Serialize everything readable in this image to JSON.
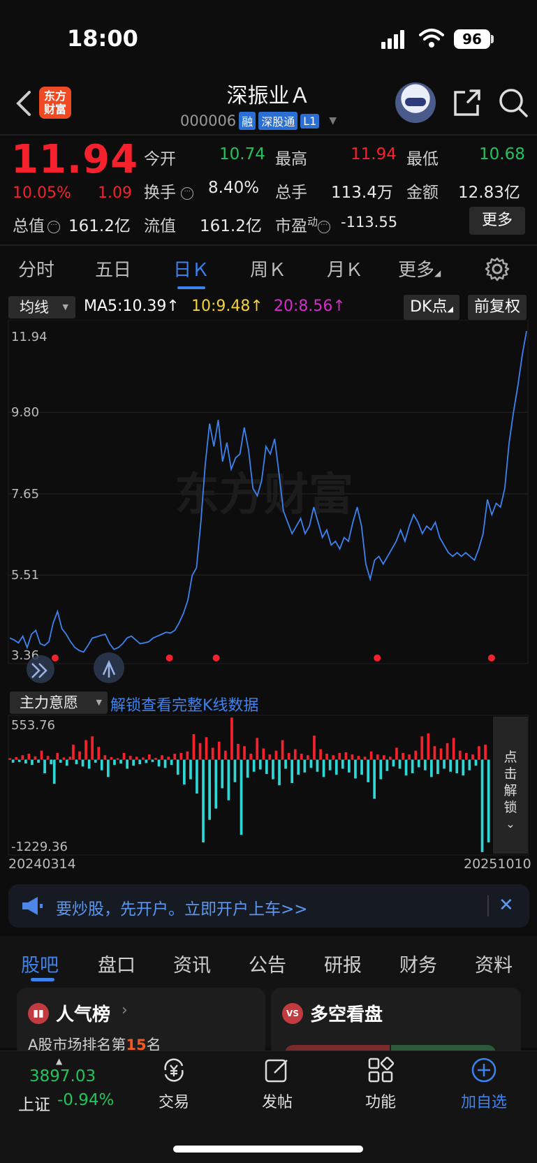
{
  "status_bar": {
    "time": "18:00",
    "battery": "96"
  },
  "header": {
    "logo_text": "东方财富",
    "stock_name": "深振业Ａ",
    "stock_code": "000006",
    "tags": [
      "融",
      "深股通",
      "L1"
    ]
  },
  "quote": {
    "price": "11.94",
    "change_pct": "10.05%",
    "change_amt": "1.09",
    "open": {
      "label": "今开",
      "value": "10.74"
    },
    "high": {
      "label": "最高",
      "value": "11.94"
    },
    "low": {
      "label": "最低",
      "value": "10.68"
    },
    "turnover_rate": {
      "label": "换手",
      "value": "8.40%"
    },
    "volume": {
      "label": "总手",
      "value": "113.4万"
    },
    "amount": {
      "label": "金额",
      "value": "12.83亿"
    },
    "total_cap": {
      "label": "总值",
      "value": "161.2亿"
    },
    "float_cap": {
      "label": "流值",
      "value": "161.2亿"
    },
    "pe": {
      "label": "市盈",
      "sup": "动",
      "value": "-113.55"
    },
    "more_label": "更多"
  },
  "period_tabs": [
    "分时",
    "五日",
    "日Ｋ",
    "周Ｋ",
    "月Ｋ",
    "更多"
  ],
  "ma_bar": {
    "select_label": "均线",
    "ma5": "MA5:10.39",
    "ma10": "10:9.48",
    "ma20": "20:8.56",
    "arrow": "↑",
    "dk_label": "DK点",
    "adjust_label": "前复权",
    "colors": {
      "ma5": "#ffffff",
      "ma10": "#f5d235",
      "ma20": "#d52dc9",
      "line": "#3d83f0"
    }
  },
  "chart_data": [
    {
      "type": "line",
      "ylim": [
        3.36,
        11.94
      ],
      "y_ticks": [
        "11.94",
        "9.80",
        "7.65",
        "5.51",
        "3.36"
      ],
      "watermark": "东方财富",
      "x_start": "20240314",
      "x_end": "20251010",
      "series": [
        {
          "values": [
            3.85,
            3.8,
            3.72,
            3.9,
            3.6,
            3.95,
            4.05,
            3.7,
            3.65,
            3.75,
            4.25,
            4.55,
            4.1,
            3.95,
            3.75,
            3.6,
            3.52,
            3.48,
            3.65,
            3.85,
            3.88,
            3.92,
            3.95,
            3.7,
            3.55,
            3.6,
            3.7,
            3.85,
            3.9,
            3.8,
            3.7,
            3.72,
            3.75,
            3.85,
            3.9,
            3.95,
            4.0,
            3.98,
            4.05,
            4.25,
            4.5,
            4.85,
            5.5,
            5.7,
            6.9,
            8.4,
            9.5,
            8.9,
            9.6,
            8.5,
            9.0,
            8.3,
            8.6,
            8.7,
            9.4,
            8.8,
            7.8,
            7.6,
            8.0,
            8.9,
            8.7,
            9.1,
            8.2,
            7.2,
            6.9,
            6.6,
            6.8,
            7.0,
            6.6,
            6.8,
            7.3,
            6.9,
            6.5,
            6.7,
            6.3,
            6.4,
            6.2,
            6.5,
            6.4,
            6.9,
            7.3,
            6.8,
            5.8,
            5.4,
            5.9,
            6.0,
            5.8,
            6.0,
            6.2,
            6.4,
            6.7,
            6.4,
            6.8,
            7.1,
            6.9,
            6.6,
            6.8,
            6.7,
            6.9,
            6.5,
            6.3,
            6.1,
            6.0,
            6.1,
            6.0,
            6.1,
            6.0,
            5.9,
            6.2,
            6.6,
            7.5,
            7.1,
            7.4,
            7.3,
            7.8,
            9.0,
            9.8,
            10.5,
            11.3,
            11.94
          ]
        }
      ],
      "marker_color": "#f5222d",
      "markers_x": [
        0.09,
        0.31,
        0.4,
        0.71,
        0.93
      ]
    },
    {
      "type": "bar",
      "ylim": [
        -1229.36,
        553.76
      ],
      "y_ticks": [
        "553.76",
        "-1229.36"
      ],
      "colors": {
        "positive": "#f5222d",
        "negative": "#2fd6d6"
      },
      "values": [
        20,
        -40,
        35,
        -30,
        60,
        -50,
        80,
        -70,
        45,
        -40,
        120,
        -180,
        50,
        -60,
        -320,
        90,
        -40,
        30,
        -80,
        40,
        200,
        -60,
        110,
        -90,
        260,
        -120,
        310,
        -40,
        170,
        -140,
        60,
        -230,
        35,
        -70,
        20,
        -50,
        90,
        -120,
        50,
        -80,
        40,
        -60,
        30,
        -45,
        70,
        -30,
        25,
        -90,
        60,
        -110,
        40,
        -70,
        80,
        -200,
        90,
        -330,
        110,
        -260,
        340,
        -450,
        220,
        -1100,
        300,
        -800,
        160,
        -650,
        240,
        -380,
        120,
        -540,
        560,
        -300,
        210,
        -1000,
        180,
        -240,
        80,
        -160,
        290,
        -130,
        150,
        -190,
        70,
        -260,
        120,
        -340,
        260,
        -120,
        90,
        -310,
        140,
        -200,
        80,
        -170,
        60,
        -110,
        320,
        -160,
        140,
        -230,
        80,
        -140,
        60,
        -200,
        90,
        -120,
        100,
        -170,
        70,
        -250,
        50,
        -200,
        40,
        -300,
        110,
        -520,
        70,
        -260,
        60,
        -150,
        40,
        -90,
        160,
        -120,
        90,
        -210,
        70,
        -180,
        120,
        -100,
        310,
        -140,
        350,
        -230,
        180,
        -190,
        150,
        -120,
        220,
        -160,
        290,
        -180,
        120,
        -210,
        90,
        -140,
        70,
        -80,
        180,
        -1229,
        200,
        -1100
      ]
    }
  ],
  "indicator_bar": {
    "select_label": "主力意愿",
    "unlock_link": "解锁查看完整K线数据",
    "side_unlock": [
      "点",
      "击",
      "解",
      "锁"
    ]
  },
  "banner": {
    "text": "要炒股，先开户。立即开户上车>>"
  },
  "bottom_tabs": [
    "股吧",
    "盘口",
    "资讯",
    "公告",
    "研报",
    "财务",
    "资料"
  ],
  "cards": {
    "popularity": {
      "title": "人气榜",
      "sub_prefix": "A股市场排名第",
      "rank": "15",
      "sub_suffix": "名",
      "icon": "rank-icon"
    },
    "bull_bear": {
      "title": "多空看盘",
      "icon": "vs-icon"
    }
  },
  "bottom_nav": {
    "index_value": "3897.03",
    "index_name": "上证",
    "index_change": "-0.94%",
    "items": [
      {
        "label": "交易",
        "icon": "yen-exchange-icon"
      },
      {
        "label": "发帖",
        "icon": "compose-icon"
      },
      {
        "label": "功能",
        "icon": "grid-icon"
      },
      {
        "label": "加自选",
        "icon": "plus-circle-icon"
      }
    ]
  }
}
